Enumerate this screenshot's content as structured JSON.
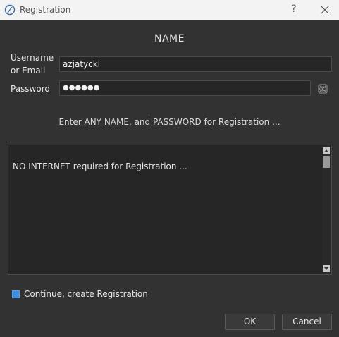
{
  "window": {
    "title": "Registration",
    "help_label": "?",
    "close_label": "close",
    "icon": "app-logo-icon"
  },
  "form": {
    "heading": "NAME",
    "username_label_line1": "Username",
    "username_label_line2": "or Email",
    "username_value": "azjatycki",
    "password_label": "Password",
    "password_value": "●●●●●●",
    "hint": "Enter ANY NAME, and PASSWORD for Registration ..."
  },
  "info_box": {
    "text": "NO INTERNET required for Registration ..."
  },
  "checkbox": {
    "label": "Continue, create Registration",
    "checked": true
  },
  "buttons": {
    "ok": "OK",
    "cancel": "Cancel"
  },
  "colors": {
    "background": "#323232",
    "field": "#262626",
    "accent": "#3b8ee0"
  }
}
